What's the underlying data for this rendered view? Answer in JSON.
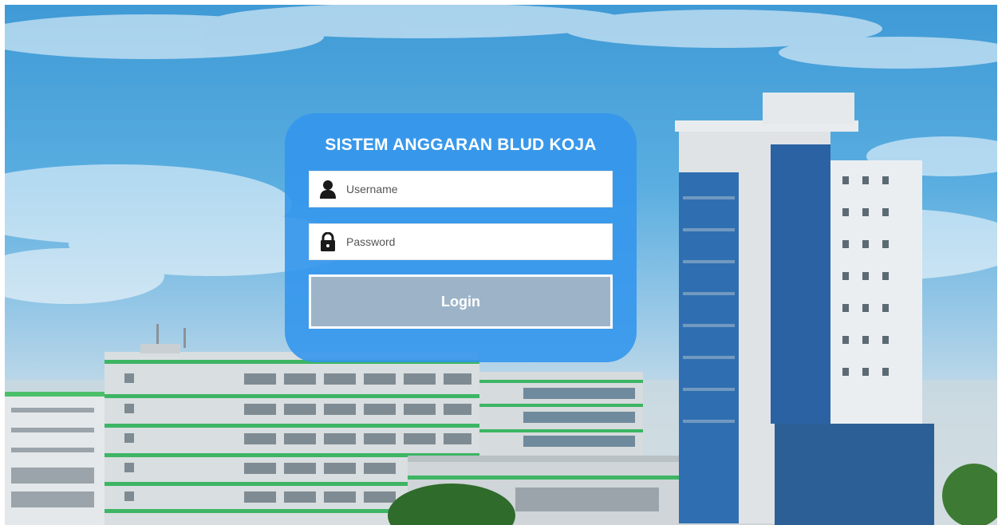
{
  "login": {
    "title": "SISTEM ANGGARAN BLUD KOJA",
    "username": {
      "icon": "user-icon",
      "placeholder": "Username",
      "value": ""
    },
    "password": {
      "icon": "lock-icon",
      "placeholder": "Password",
      "value": ""
    },
    "submit_label": "Login"
  },
  "background": {
    "image": "hospital-buildings-photo"
  },
  "colors": {
    "card": "#3496EC",
    "button": "#9DB4C8",
    "text_light": "#FFFFFF",
    "icon": "#1A1A1A"
  }
}
